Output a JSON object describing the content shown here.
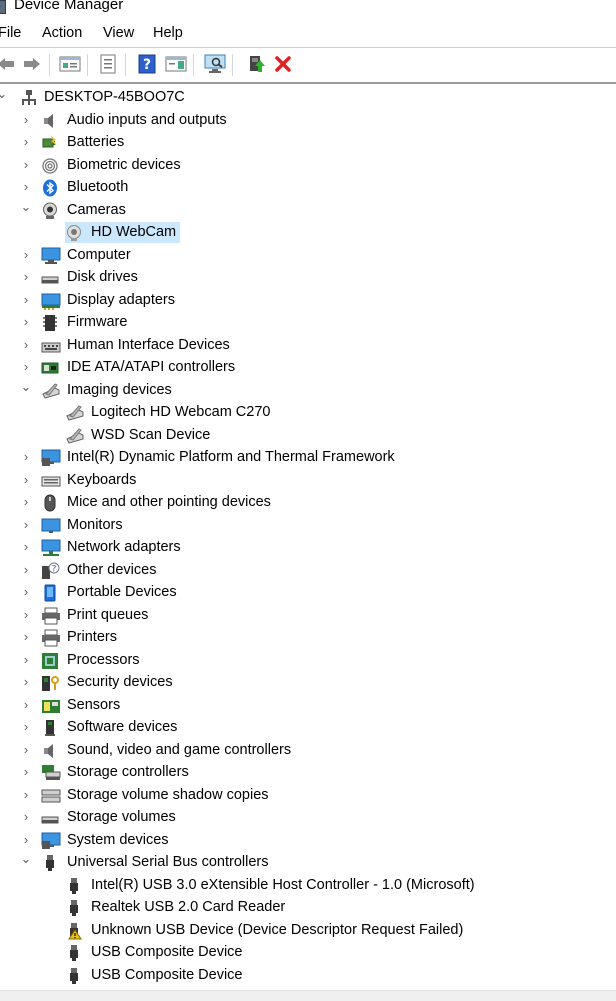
{
  "window": {
    "title": "Device Manager"
  },
  "menu": {
    "items": [
      "File",
      "Action",
      "View",
      "Help"
    ]
  },
  "toolbar": {
    "buttons": [
      "back-icon",
      "forward-icon",
      "properties-view-icon",
      "show-hidden-icon",
      "help-icon",
      "action-pane-icon",
      "scan-hardware-icon",
      "update-driver-icon",
      "uninstall-icon"
    ]
  },
  "tree": {
    "root": "DESKTOP-45BOO7C",
    "nodes": [
      {
        "label": "Audio inputs and outputs",
        "icon": "speaker-icon",
        "expanded": false
      },
      {
        "label": "Batteries",
        "icon": "battery-icon",
        "expanded": false
      },
      {
        "label": "Biometric devices",
        "icon": "fingerprint-icon",
        "expanded": false
      },
      {
        "label": "Bluetooth",
        "icon": "bluetooth-icon",
        "expanded": false
      },
      {
        "label": "Cameras",
        "icon": "camera-icon",
        "expanded": true,
        "children": [
          {
            "label": "HD WebCam",
            "icon": "webcam-icon",
            "selected": true
          }
        ]
      },
      {
        "label": "Computer",
        "icon": "computer-icon",
        "expanded": false
      },
      {
        "label": "Disk drives",
        "icon": "disk-drive-icon",
        "expanded": false
      },
      {
        "label": "Display adapters",
        "icon": "display-adapter-icon",
        "expanded": false
      },
      {
        "label": "Firmware",
        "icon": "firmware-icon",
        "expanded": false
      },
      {
        "label": "Human Interface Devices",
        "icon": "hid-icon",
        "expanded": false
      },
      {
        "label": "IDE ATA/ATAPI controllers",
        "icon": "ide-controller-icon",
        "expanded": false
      },
      {
        "label": "Imaging devices",
        "icon": "scanner-icon",
        "expanded": true,
        "children": [
          {
            "label": "Logitech HD Webcam C270",
            "icon": "scanner-icon"
          },
          {
            "label": "WSD Scan Device",
            "icon": "scanner-icon"
          }
        ]
      },
      {
        "label": "Intel(R) Dynamic Platform and Thermal Framework",
        "icon": "system-device-icon",
        "expanded": false
      },
      {
        "label": "Keyboards",
        "icon": "keyboard-icon",
        "expanded": false
      },
      {
        "label": "Mice and other pointing devices",
        "icon": "mouse-icon",
        "expanded": false
      },
      {
        "label": "Monitors",
        "icon": "monitor-icon",
        "expanded": false
      },
      {
        "label": "Network adapters",
        "icon": "network-adapter-icon",
        "expanded": false
      },
      {
        "label": "Other devices",
        "icon": "unknown-device-icon",
        "expanded": false
      },
      {
        "label": "Portable Devices",
        "icon": "portable-device-icon",
        "expanded": false
      },
      {
        "label": "Print queues",
        "icon": "printer-icon",
        "expanded": false
      },
      {
        "label": "Printers",
        "icon": "printer-icon",
        "expanded": false
      },
      {
        "label": "Processors",
        "icon": "processor-icon",
        "expanded": false
      },
      {
        "label": "Security devices",
        "icon": "security-device-icon",
        "expanded": false
      },
      {
        "label": "Sensors",
        "icon": "sensor-icon",
        "expanded": false
      },
      {
        "label": "Software devices",
        "icon": "software-device-icon",
        "expanded": false
      },
      {
        "label": "Sound, video and game controllers",
        "icon": "speaker-icon",
        "expanded": false
      },
      {
        "label": "Storage controllers",
        "icon": "storage-controller-icon",
        "expanded": false
      },
      {
        "label": "Storage volume shadow copies",
        "icon": "storage-volume-icon",
        "expanded": false
      },
      {
        "label": "Storage volumes",
        "icon": "disk-drive-icon",
        "expanded": false
      },
      {
        "label": "System devices",
        "icon": "system-device-icon",
        "expanded": false
      },
      {
        "label": "Universal Serial Bus controllers",
        "icon": "usb-icon",
        "expanded": true,
        "children": [
          {
            "label": "Intel(R) USB 3.0 eXtensible Host Controller - 1.0 (Microsoft)",
            "icon": "usb-icon"
          },
          {
            "label": "Realtek USB 2.0 Card Reader",
            "icon": "usb-icon"
          },
          {
            "label": "Unknown USB Device (Device Descriptor Request Failed)",
            "icon": "usb-warning-icon"
          },
          {
            "label": "USB Composite Device",
            "icon": "usb-icon"
          },
          {
            "label": "USB Composite Device",
            "icon": "usb-icon"
          }
        ]
      }
    ]
  },
  "colors": {
    "selection": "#cce8ff",
    "accent": "#1e90ff",
    "uninstall": "#e02020"
  }
}
